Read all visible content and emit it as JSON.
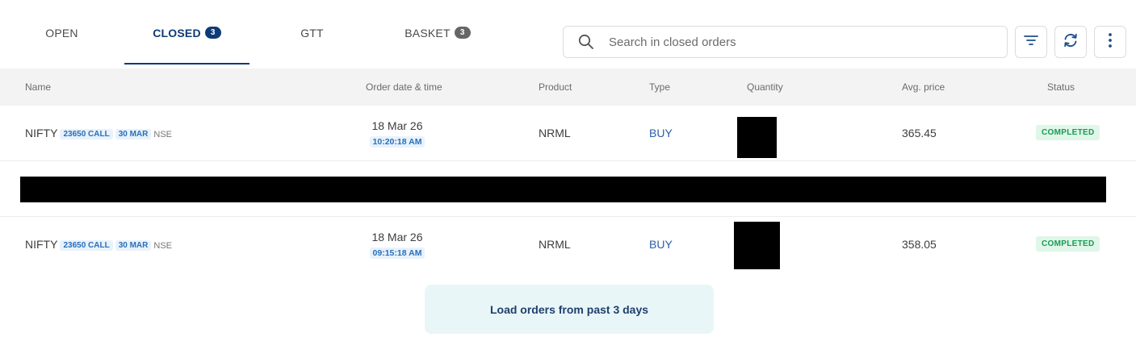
{
  "tabs": [
    {
      "label": "OPEN",
      "count": null
    },
    {
      "label": "CLOSED",
      "count": "3"
    },
    {
      "label": "GTT",
      "count": null
    },
    {
      "label": "BASKET",
      "count": "3"
    }
  ],
  "active_tab": "CLOSED",
  "search": {
    "placeholder": "Search in closed orders",
    "value": ""
  },
  "toolbar": {
    "filter_icon": "filter-icon",
    "refresh_icon": "refresh-icon",
    "more_icon": "more-vertical-icon"
  },
  "columns": {
    "name": "Name",
    "order_datetime": "Order date & time",
    "product": "Product",
    "type": "Type",
    "quantity": "Quantity",
    "avg_price": "Avg. price",
    "status": "Status"
  },
  "rows": [
    {
      "symbol": "NIFTY",
      "strike": "23650 CALL",
      "expiry": "30 MAR",
      "exchange": "NSE",
      "date": "18 Mar 26",
      "time": "10:20:18 AM",
      "product": "NRML",
      "type": "BUY",
      "quantity": "[redacted]",
      "avg_price": "365.45",
      "status": "COMPLETED"
    },
    {
      "symbol": "NIFTY",
      "strike": "23650 CALL",
      "expiry": "30 MAR",
      "exchange": "NSE",
      "date": "18 Mar 26",
      "time": "09:15:18 AM",
      "product": "NRML",
      "type": "BUY",
      "quantity": "[redacted]",
      "avg_price": "358.05",
      "status": "COMPLETED"
    }
  ],
  "redacted_row": true,
  "load_more": {
    "label": "Load orders from past 3 days"
  },
  "colors": {
    "accent": "#0d3b78",
    "chip_text": "#2a6fb8",
    "chip_bg": "#e8f2fc",
    "status_text": "#1a9a55",
    "status_bg": "#dff6e8",
    "load_bg": "#e9f6f8"
  }
}
